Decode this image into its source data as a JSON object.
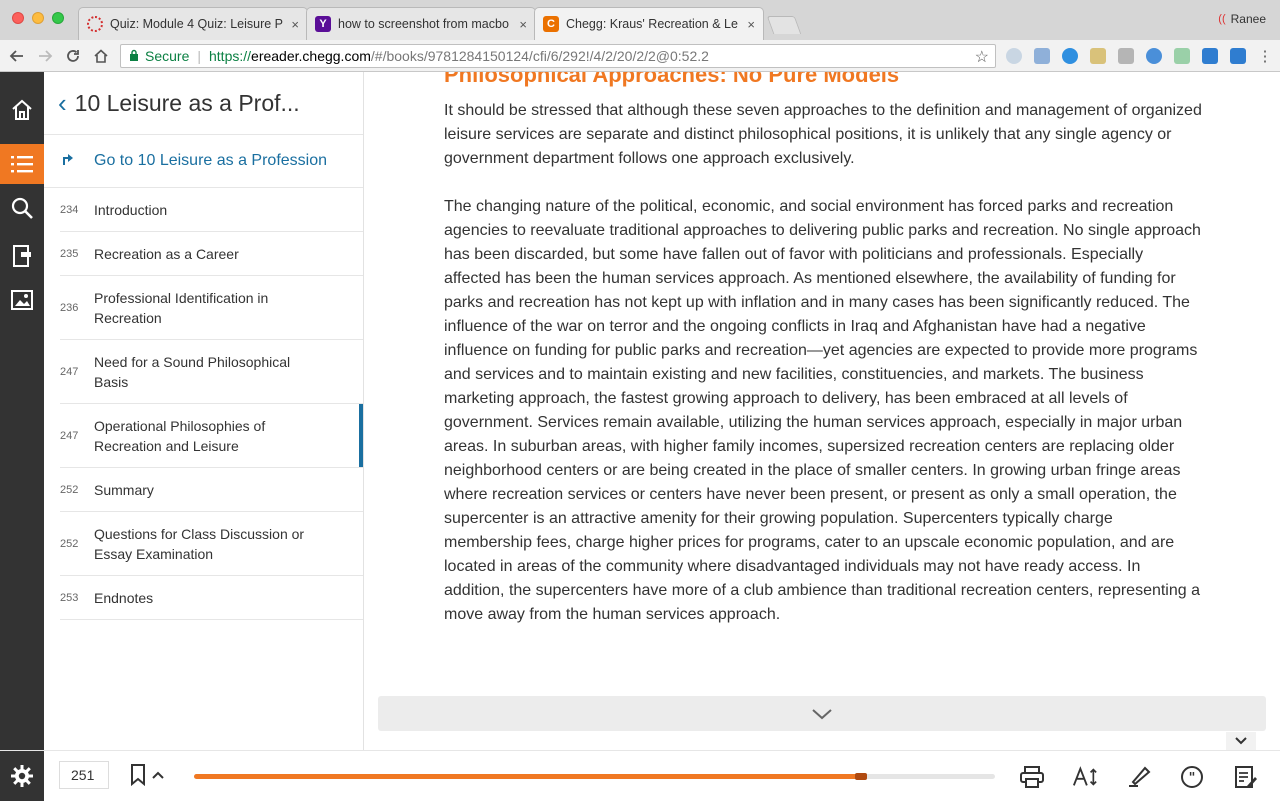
{
  "browser": {
    "tabs": [
      {
        "title": "Quiz: Module 4 Quiz: Leisure P",
        "favicon": "quiz-favicon"
      },
      {
        "title": "how to screenshot from macbo",
        "favicon": "yahoo-favicon"
      },
      {
        "title": "Chegg: Kraus' Recreation & Le",
        "favicon": "chegg-favicon",
        "active": true
      }
    ],
    "tab_close_glyph": "×",
    "profile_name": "Ranee",
    "address": {
      "secure_label": "Secure",
      "scheme": "https://",
      "host": "ereader.chegg.com",
      "path": "/#/books/9781284150124/cfi/6/292!/4/2/20/2/2@0:52.2"
    }
  },
  "toc": {
    "header_title": "10 Leisure as a Prof...",
    "goto_label": "Go to 10 Leisure as a Profession",
    "items": [
      {
        "page": "234",
        "label": "Introduction"
      },
      {
        "page": "235",
        "label": "Recreation as a Career"
      },
      {
        "page": "236",
        "label": "Professional Identification in Recreation"
      },
      {
        "page": "247",
        "label": "Need for a Sound Philosophical Basis"
      },
      {
        "page": "247",
        "label": "Operational Philosophies of Recreation and Leisure",
        "current": true
      },
      {
        "page": "252",
        "label": "Summary"
      },
      {
        "page": "252",
        "label": "Questions for Class Discussion or Essay Examination"
      },
      {
        "page": "253",
        "label": "Endnotes"
      }
    ]
  },
  "reader": {
    "section_heading": "Philosophical Approaches: No Pure Models",
    "paragraphs": [
      "It should be stressed that although these seven approaches to the definition and management of organized leisure services are separate and distinct philosophical positions, it is unlikely that any single agency or government department follows one approach exclusively.",
      "The changing nature of the political, economic, and social environment has forced parks and recreation agencies to reevaluate traditional approaches to delivering public parks and recreation. No single approach has been discarded, but some have fallen out of favor with politicians and professionals. Especially affected has been the human services approach. As mentioned elsewhere, the availability of funding for parks and recreation has not kept up with inflation and in many cases has been significantly reduced. The influence of the war on terror and the ongoing conflicts in Iraq and Afghanistan have had a negative influence on funding for public parks and recreation—yet agencies are expected to provide more programs and services and to maintain existing and new facilities, constituencies, and markets. The business marketing approach, the fastest growing approach to delivery, has been embraced at all levels of government. Services remain available, utilizing the human services approach, especially in major urban areas. In suburban areas, with higher family incomes, supersized recreation centers are replacing older neighborhood centers or are being created in the place of smaller centers. In growing urban fringe areas where recreation services or centers have never been present, or present as only a small operation, the supercenter is an attractive amenity for their growing population. Supercenters typically charge membership fees, charge higher prices for programs, cater to an upscale economic population, and are located in areas of the community where disadvantaged individuals may not have ready access. In addition, the supercenters have more of a club ambience than traditional recreation centers, representing a move away from the human services approach."
    ]
  },
  "footer": {
    "page_number": "251",
    "reading_progress": 0.84
  },
  "colors": {
    "accent": "#f07822",
    "link": "#1a6fa0",
    "rail": "#333333"
  }
}
